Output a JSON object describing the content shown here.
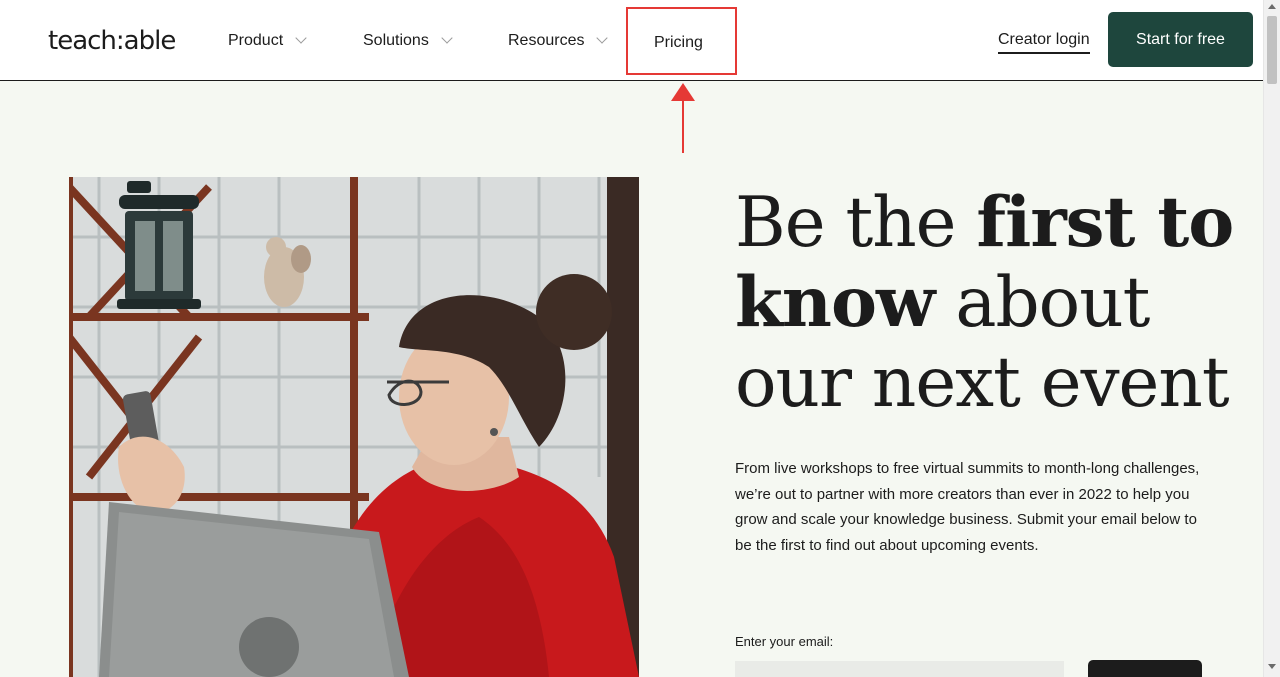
{
  "nav": {
    "logo": "teach:able",
    "items": [
      {
        "label": "Product"
      },
      {
        "label": "Solutions"
      },
      {
        "label": "Resources"
      }
    ],
    "pricing_label": "Pricing",
    "login_label": "Creator login",
    "start_label": "Start for free"
  },
  "hero": {
    "headline_1": "Be the ",
    "headline_bold_1": "first to",
    "headline_bold_2": "know",
    "headline_2": " about",
    "headline_3": "our next event",
    "description": "From live workshops to free virtual summits to month-long challenges, we’re out to partner with more creators than ever in 2022 to help you grow and scale your knowledge business. Submit your email below to be the first to find out about upcoming events.",
    "email_label": "Enter your email:"
  },
  "colors": {
    "accent": "#1e463d",
    "annotation": "#e53935",
    "background": "#f5f8f2"
  }
}
